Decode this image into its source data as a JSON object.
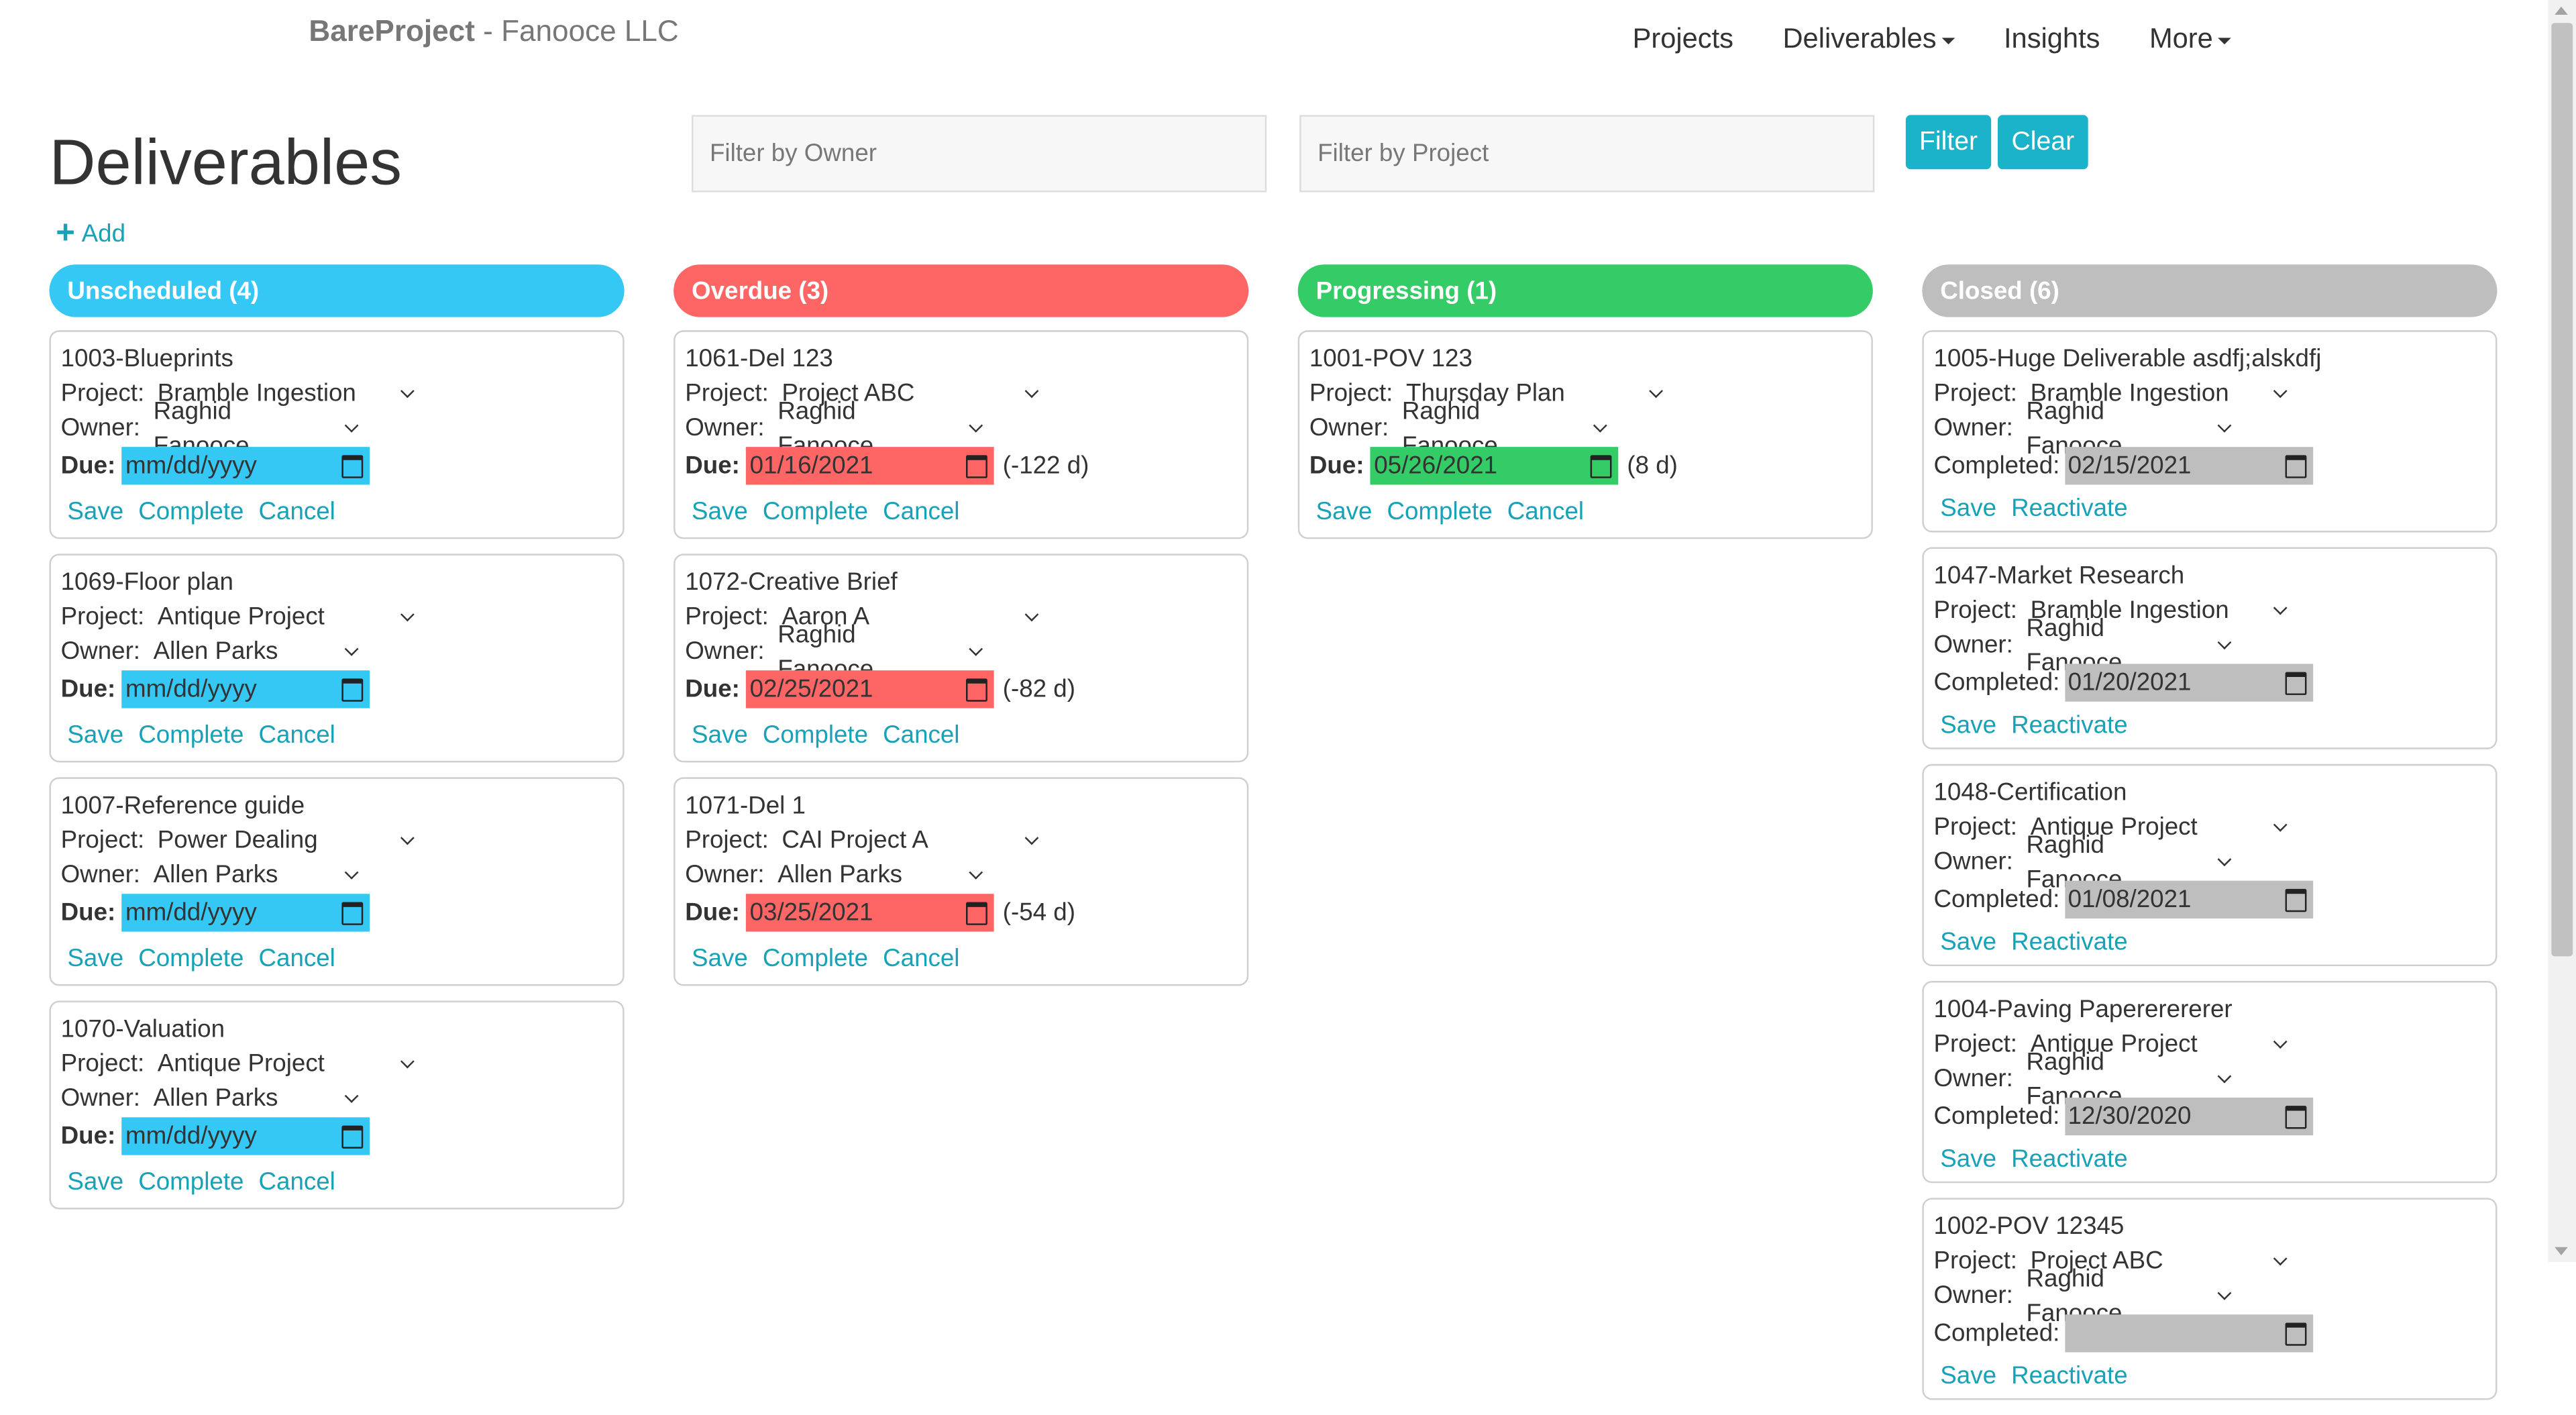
{
  "brand": {
    "name": "BareProject",
    "separator": " - ",
    "company": "Fanooce LLC"
  },
  "nav": {
    "projects": "Projects",
    "deliverables": "Deliverables",
    "insights": "Insights",
    "more": "More"
  },
  "page": {
    "title": "Deliverables",
    "add_label": "Add"
  },
  "filters": {
    "owner_placeholder": "Filter by Owner",
    "project_placeholder": "Filter by Project",
    "filter_button": "Filter",
    "clear_button": "Clear"
  },
  "labels": {
    "project": "Project:",
    "owner": "Owner:",
    "due": "Due:",
    "completed": "Completed:",
    "save": "Save",
    "complete": "Complete",
    "cancel": "Cancel",
    "reactivate": "Reactivate"
  },
  "colors": {
    "unscheduled": "#35c8f5",
    "overdue": "#fe6666",
    "progressing": "#33cc66",
    "closed": "#bebebe",
    "accent": "#17a2b8"
  },
  "columns": [
    {
      "key": "unscheduled",
      "title": "Unscheduled (4)",
      "cards": [
        {
          "title": "1003-Blueprints",
          "project": "Bramble Ingestion",
          "owner": "Raghid Fanooce",
          "date": "mm/dd/yyyy",
          "days": ""
        },
        {
          "title": "1069-Floor plan",
          "project": "Antique Project",
          "owner": "Allen Parks",
          "date": "mm/dd/yyyy",
          "days": ""
        },
        {
          "title": "1007-Reference guide",
          "project": "Power Dealing",
          "owner": "Allen Parks",
          "date": "mm/dd/yyyy",
          "days": ""
        },
        {
          "title": "1070-Valuation",
          "project": "Antique Project",
          "owner": "Allen Parks",
          "date": "mm/dd/yyyy",
          "days": ""
        }
      ]
    },
    {
      "key": "overdue",
      "title": "Overdue (3)",
      "cards": [
        {
          "title": "1061-Del 123",
          "project": "Project ABC",
          "owner": "Raghid Fanooce",
          "date": "01/16/2021",
          "days": "(-122 d)"
        },
        {
          "title": "1072-Creative Brief",
          "project": "Aaron A",
          "owner": "Raghid Fanooce",
          "date": "02/25/2021",
          "days": "(-82 d)"
        },
        {
          "title": "1071-Del 1",
          "project": "CAI Project A",
          "owner": "Allen Parks",
          "date": "03/25/2021",
          "days": "(-54 d)"
        }
      ]
    },
    {
      "key": "progressing",
      "title": "Progressing (1)",
      "cards": [
        {
          "title": "1001-POV 123",
          "project": "Thursday Plan",
          "owner": "Raghid Fanooce",
          "date": "05/26/2021",
          "days": "(8 d)"
        }
      ]
    },
    {
      "key": "closed",
      "title": "Closed (6)",
      "cards": [
        {
          "title": "1005-Huge Deliverable asdfj;alskdfj",
          "project": "Bramble Ingestion",
          "owner": "Raghid Fanooce",
          "date": "02/15/2021",
          "days": ""
        },
        {
          "title": "1047-Market Research",
          "project": "Bramble Ingestion",
          "owner": "Raghid Fanooce",
          "date": "01/20/2021",
          "days": ""
        },
        {
          "title": "1048-Certification",
          "project": "Antique Project",
          "owner": "Raghid Fanooce",
          "date": "01/08/2021",
          "days": ""
        },
        {
          "title": "1004-Paving Papererererer",
          "project": "Antique Project",
          "owner": "Raghid Fanooce",
          "date": "12/30/2020",
          "days": ""
        },
        {
          "title": "1002-POV 12345",
          "project": "Project ABC",
          "owner": "Raghid Fanooce",
          "date": "",
          "days": ""
        }
      ]
    }
  ]
}
